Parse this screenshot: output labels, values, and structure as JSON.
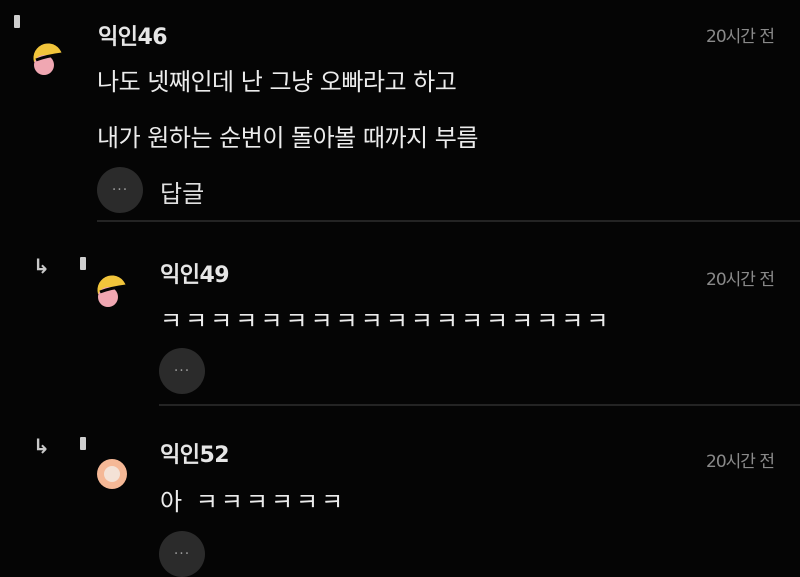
{
  "comments": [
    {
      "author": "익인46",
      "time": "20시간 전",
      "lines": [
        "나도 넷째인데 난 그냥 오빠라고 하고",
        "내가 원하는 순번이 돌아볼 때까지 부름"
      ],
      "more_label": "···",
      "reply_label": "답글",
      "avatar_color": "#f2c53b",
      "avatar_accent": "#f0a7b2"
    },
    {
      "author": "익인49",
      "time": "20시간 전",
      "text": "ㅋㅋㅋㅋㅋㅋㅋㅋㅋㅋㅋㅋㅋㅋㅋㅋㅋㅋ",
      "more_label": "···",
      "avatar_color": "#f2c53b",
      "avatar_accent": "#f0a7b2"
    },
    {
      "author": "익인52",
      "time": "20시간 전",
      "text": "아 ㅋㅋㅋㅋㅋㅋ",
      "more_label": "···",
      "avatar_color": "#f5b896",
      "avatar_accent": "#f4e2d6"
    }
  ]
}
